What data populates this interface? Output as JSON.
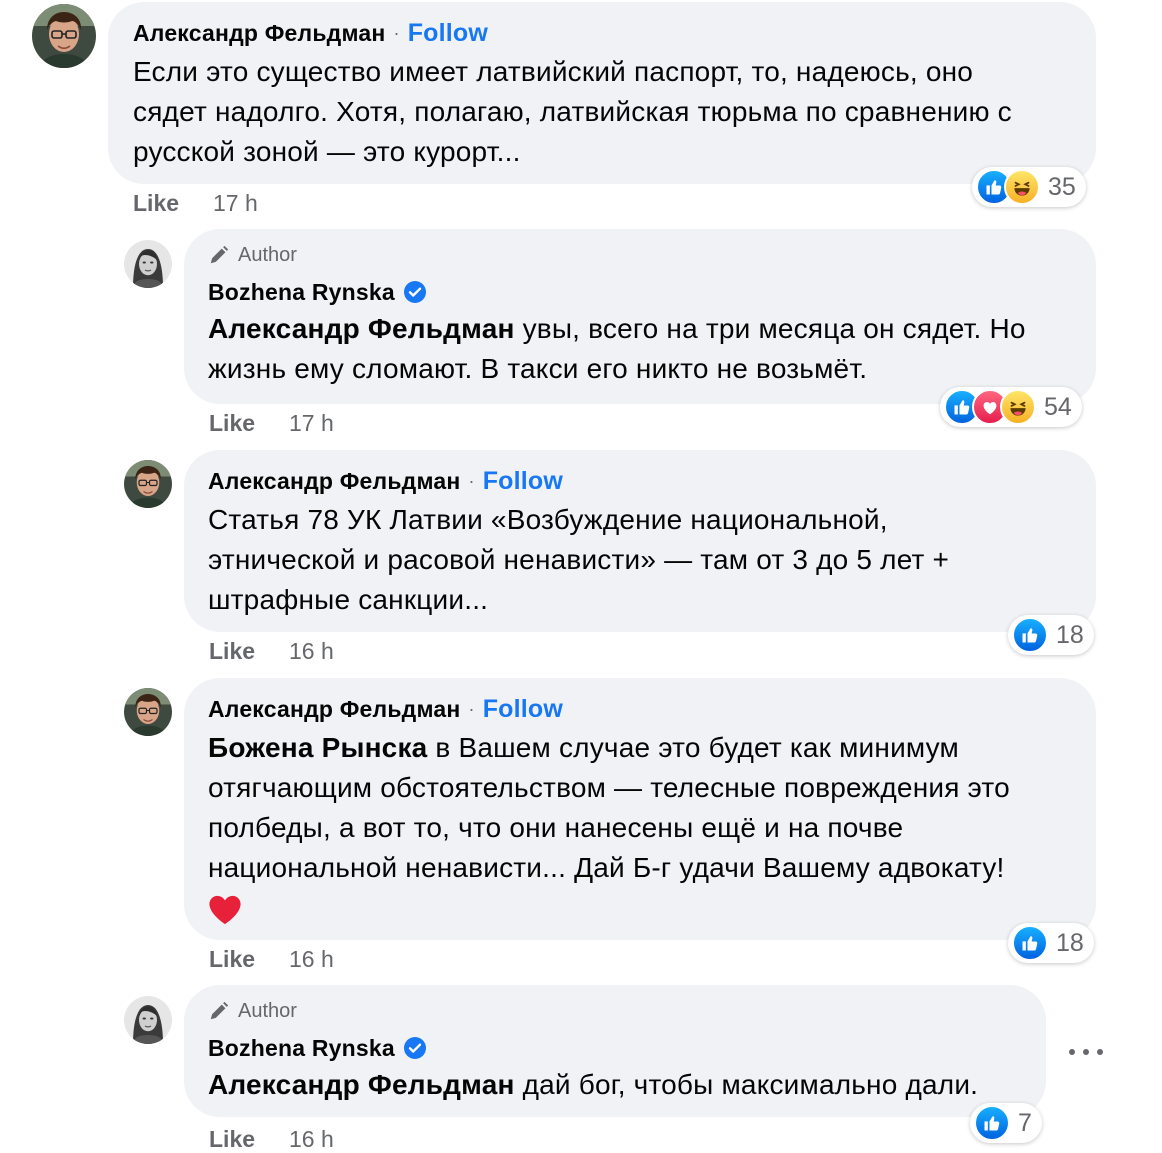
{
  "colors": {
    "bubble": "#f0f2f5",
    "accent": "#1877f2",
    "secondary": "#65676b"
  },
  "comments": [
    {
      "name": "Александр Фельдман",
      "follow": "Follow",
      "lines": [
        "Если это существо имеет латвийский паспорт, то, надеюсь, оно",
        "сядет надолго. Хотя, полагаю, латвийская тюрьма по сравнению с",
        "русской зоной — это курорт..."
      ],
      "like": "Like",
      "time": "17 h",
      "reactions": [
        "like-icon",
        "haha-icon"
      ],
      "count": "35"
    },
    {
      "author_badge": "Author",
      "name": "Bozhena Rynska",
      "mention": "Александр Фельдман",
      "line1_rest": " увы, всего на три месяца он сядет. Но",
      "line2": "жизнь ему сломают. В такси его никто не возьмёт.",
      "like": "Like",
      "time": "17 h",
      "reactions": [
        "like-icon",
        "love-icon",
        "haha-icon"
      ],
      "count": "54"
    },
    {
      "name": "Александр Фельдман",
      "follow": "Follow",
      "lines": [
        "Статья 78 УК Латвии «Возбуждение национальной,",
        "этнической и расовой ненависти» — там от 3 до 5 лет +",
        "штрафные санкции..."
      ],
      "like": "Like",
      "time": "16 h",
      "reactions": [
        "like-icon"
      ],
      "count": "18"
    },
    {
      "name": "Александр Фельдман",
      "follow": "Follow",
      "mention": "Божена Рынска",
      "line1_rest": " в Вашем случае это будет как минимум",
      "lines": [
        "отягчающим обстоятельством — телесные повреждения это",
        "полбеды, а вот то, что они нанесены ещё и на почве",
        "национальной ненависти... Дай Б-г удачи Вашему адвокату!"
      ],
      "emoji": "heart-emoji",
      "like": "Like",
      "time": "16 h",
      "reactions": [
        "like-icon"
      ],
      "count": "18"
    },
    {
      "author_badge": "Author",
      "name": "Bozhena Rynska",
      "mention": "Александр Фельдман",
      "line1_rest": " дай бог, чтобы максимально дали.",
      "like": "Like",
      "time": "16 h",
      "reactions": [
        "like-icon"
      ],
      "count": "7"
    }
  ]
}
